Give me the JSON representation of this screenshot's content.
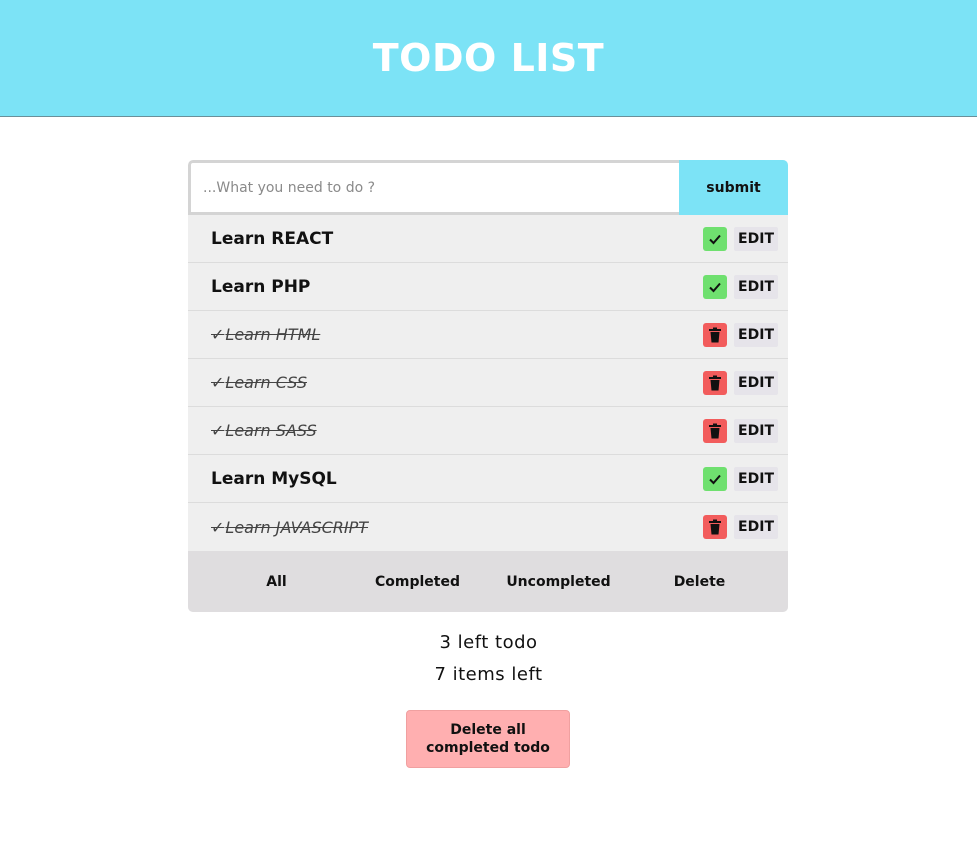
{
  "header": {
    "title": "TODO LIST"
  },
  "form": {
    "placeholder": "...What you need to do ?",
    "submit_label": "submit"
  },
  "todos": [
    {
      "text": "Learn REACT",
      "done": false,
      "edit_label": "EDIT"
    },
    {
      "text": "Learn PHP",
      "done": false,
      "edit_label": "EDIT"
    },
    {
      "text": "Learn HTML",
      "done": true,
      "edit_label": "EDIT"
    },
    {
      "text": "Learn CSS",
      "done": true,
      "edit_label": "EDIT"
    },
    {
      "text": "Learn SASS",
      "done": true,
      "edit_label": "EDIT"
    },
    {
      "text": "Learn MySQL",
      "done": false,
      "edit_label": "EDIT"
    },
    {
      "text": "Learn JAVASCRIPT",
      "done": true,
      "edit_label": "EDIT"
    }
  ],
  "done_prefix": "✓",
  "filters": {
    "all": "All",
    "completed": "Completed",
    "uncompleted": "Uncompleted",
    "delete": "Delete"
  },
  "stats": {
    "left_todo": "3 left todo",
    "items_left": "7 items left"
  },
  "delete_all_label": "Delete all completed todo",
  "colors": {
    "header": "#7ce3f6",
    "complete": "#6fe06f",
    "delete": "#f25c5c",
    "delete_all": "#ffafb0"
  },
  "icons": {
    "complete": "check-icon",
    "delete": "trash-icon"
  }
}
